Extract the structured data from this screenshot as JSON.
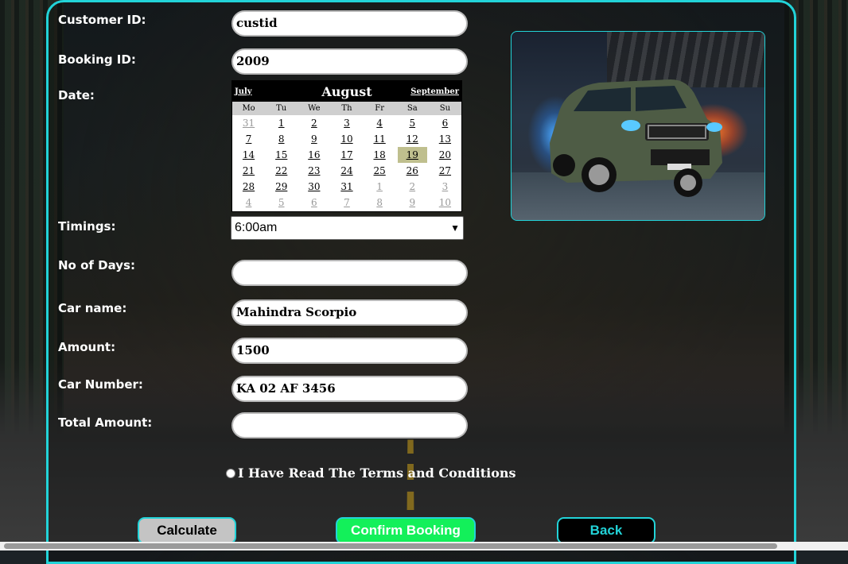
{
  "form": {
    "customer_id": {
      "label": "Customer ID:",
      "value": "custid"
    },
    "booking_id": {
      "label": "Booking ID:",
      "value": "2009"
    },
    "date": {
      "label": "Date:"
    },
    "timings": {
      "label": "Timings:",
      "value": "6:00am"
    },
    "no_of_days": {
      "label": "No of Days:",
      "value": ""
    },
    "car_name": {
      "label": "Car name:",
      "value": "Mahindra Scorpio"
    },
    "amount": {
      "label": "Amount:",
      "value": "1500"
    },
    "car_number": {
      "label": "Car Number:",
      "value": "KA 02 AF 3456"
    },
    "total_amount": {
      "label": "Total Amount:",
      "value": ""
    }
  },
  "calendar": {
    "prev_month": "July",
    "month": "August",
    "next_month": "September",
    "weekdays": [
      "Mo",
      "Tu",
      "We",
      "Th",
      "Fr",
      "Sa",
      "Su"
    ],
    "days": [
      "31",
      "1",
      "2",
      "3",
      "4",
      "5",
      "6",
      "7",
      "8",
      "9",
      "10",
      "11",
      "12",
      "13",
      "14",
      "15",
      "16",
      "17",
      "18",
      "19",
      "20",
      "21",
      "22",
      "23",
      "24",
      "25",
      "26",
      "27",
      "28",
      "29",
      "30",
      "31",
      "1",
      "2",
      "3",
      "4",
      "5",
      "6",
      "7",
      "8",
      "9",
      "10"
    ],
    "selected": "19"
  },
  "terms_label": "I Have Read The Terms and Conditions",
  "buttons": {
    "calculate": "Calculate",
    "confirm": "Confirm Booking",
    "back": "Back"
  },
  "colors": {
    "accent": "#22d3d8",
    "confirm": "#13f05a",
    "calc": "#c4c4c4"
  }
}
